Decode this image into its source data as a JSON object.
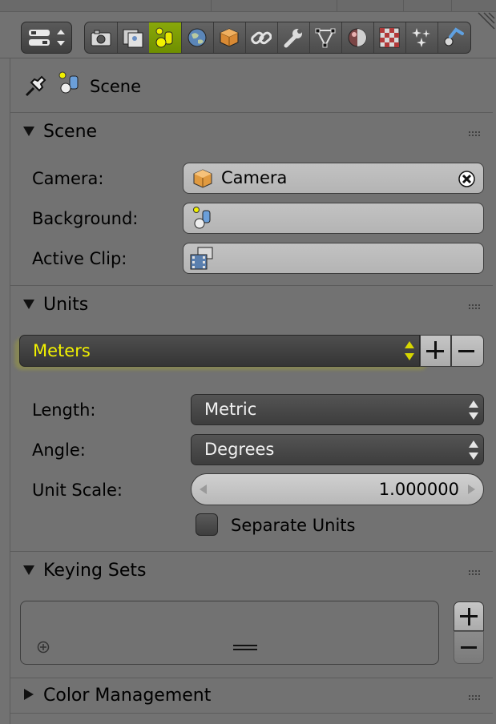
{
  "header": {
    "tabs": [
      {
        "id": "render",
        "icon": "camera-icon"
      },
      {
        "id": "render-layers",
        "icon": "render-layers-icon"
      },
      {
        "id": "scene",
        "icon": "scene-icon",
        "active": true
      },
      {
        "id": "world",
        "icon": "world-icon"
      },
      {
        "id": "object",
        "icon": "cube-icon"
      },
      {
        "id": "constraints",
        "icon": "chain-link-icon"
      },
      {
        "id": "modifiers",
        "icon": "wrench-icon"
      },
      {
        "id": "data",
        "icon": "mesh-vertex-icon"
      },
      {
        "id": "material",
        "icon": "material-sphere-icon"
      },
      {
        "id": "texture",
        "icon": "checker-texture-icon"
      },
      {
        "id": "particles",
        "icon": "particles-icon"
      },
      {
        "id": "physics",
        "icon": "physics-icon"
      }
    ]
  },
  "context": {
    "label": "Scene"
  },
  "panels": {
    "scene": {
      "title": "Scene",
      "camera_label": "Camera:",
      "camera_value": "Camera",
      "background_label": "Background:",
      "background_value": "",
      "active_clip_label": "Active Clip:",
      "active_clip_value": ""
    },
    "units": {
      "title": "Units",
      "preset": "Meters",
      "length_label": "Length:",
      "length_value": "Metric",
      "angle_label": "Angle:",
      "angle_value": "Degrees",
      "unit_scale_label": "Unit Scale:",
      "unit_scale_value": "1.000000",
      "separate_units_label": "Separate Units",
      "separate_units_checked": false
    },
    "keying_sets": {
      "title": "Keying Sets"
    },
    "color_management": {
      "title": "Color Management"
    }
  },
  "colors": {
    "background": "#727272",
    "active_tab": "#7a9a00",
    "highlight_text": "#f2f200"
  }
}
